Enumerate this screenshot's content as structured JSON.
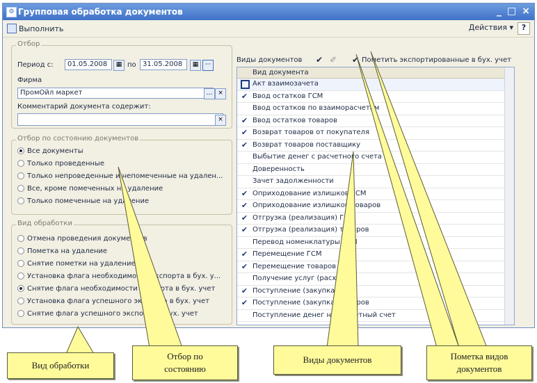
{
  "window": {
    "title": "Групповая обработка документов",
    "controls": [
      "_",
      "□",
      "×"
    ]
  },
  "toolbar": {
    "run_label": "Выполнить",
    "actions_label": "Действия ▾",
    "help_label": "?"
  },
  "filter": {
    "group_label": "Отбор",
    "period_label": "Период с:",
    "date_from": "01.05.2008",
    "to_label": "по",
    "date_to": "31.05.2008",
    "firm_label": "Фирма",
    "firm_value": "ПромОйл маркет",
    "comment_label": "Комментарий документа содержит:",
    "comment_value": ""
  },
  "state_filter": {
    "group_label": "Отбор по состоянию документов",
    "options": [
      "Все документы",
      "Только проведенные",
      "Только непроведенные и непомеченные на удален...",
      "Все, кроме помеченных на удаление",
      "Только помеченные на удаление"
    ],
    "selected_index": 0
  },
  "processing": {
    "group_label": "Вид обработки",
    "options": [
      "Отмена проведения документов",
      "Пометка на удаление",
      "Снятие пометки на удаление",
      "Установка флага необходимости экспорта в бух. у...",
      "Снятие флага необходимости экспорта в бух. учет",
      "Установка флага успешного экспорта в бух. учет",
      "Снятие флага успешного экспорта в бух. учет"
    ],
    "selected_index": 4
  },
  "doc_types": {
    "panel_label": "Виды документов",
    "mark_exported_label": "Пометить экспортированные в бух. учет",
    "column_header": "Вид документа",
    "rows": [
      {
        "name": "Акт взаимозачета",
        "checked": false
      },
      {
        "name": "Ввод остатков ГСМ",
        "checked": true
      },
      {
        "name": "Ввод остатков по взаиморасчетам",
        "checked": false
      },
      {
        "name": "Ввод остатков товаров",
        "checked": true
      },
      {
        "name": "Возврат товаров от покупателя",
        "checked": true
      },
      {
        "name": "Возврат товаров поставщику",
        "checked": true
      },
      {
        "name": "Выбытие денег с расчетного счета",
        "checked": false
      },
      {
        "name": "Доверенность",
        "checked": false
      },
      {
        "name": "Зачет задолженности",
        "checked": false
      },
      {
        "name": "Оприходование излишков ГСМ",
        "checked": true
      },
      {
        "name": "Оприходование излишков товаров",
        "checked": true
      },
      {
        "name": "Отгрузка (реализация) ГСМ",
        "checked": true
      },
      {
        "name": "Отгрузка (реализация) товаров",
        "checked": true
      },
      {
        "name": "Перевод номенклатуры ГСМ",
        "checked": false
      },
      {
        "name": "Перемещение ГСМ",
        "checked": true
      },
      {
        "name": "Перемещение товаров",
        "checked": true
      },
      {
        "name": "Получение услуг (расходов)",
        "checked": false
      },
      {
        "name": "Поступление (закупка) ГСМ",
        "checked": true
      },
      {
        "name": "Поступление (закупка) товаров",
        "checked": true
      },
      {
        "name": "Поступление денег на расчетный счет",
        "checked": false
      }
    ]
  },
  "callouts": {
    "processing_type": "Вид обработки",
    "state_filter_line1": "Отбор по",
    "state_filter_line2": "состоянию",
    "doc_types": "Виды документов",
    "mark_line1": "Пометка видов",
    "mark_line2": "документов"
  },
  "colors": {
    "title_bar": "#3f71c8",
    "callout_fill": "#fffb9b",
    "panel_bg": "#f2efe3"
  }
}
